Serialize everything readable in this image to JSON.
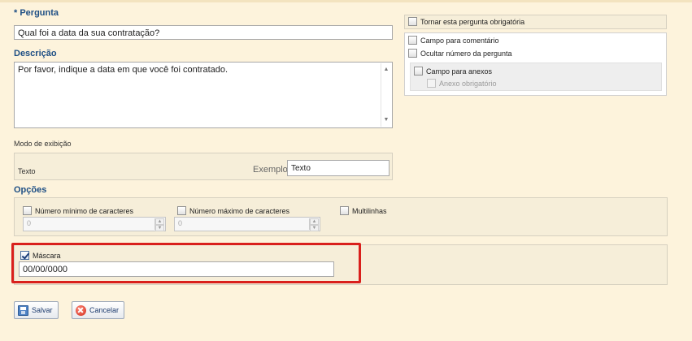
{
  "question": {
    "label": "* Pergunta",
    "value": "Qual foi a data da sua contratação?"
  },
  "description": {
    "label": "Descrição",
    "value": "Por favor, indique a data em que você foi contratado."
  },
  "options_right": {
    "required": "Tornar esta pergunta obrigatória",
    "comment_field": "Campo para comentário",
    "hide_number": "Ocultar número da pergunta",
    "attachments": "Campo para anexos",
    "attachment_required": "Anexo obrigatório"
  },
  "display_mode": {
    "label": "Modo de exibição",
    "value": "Texto",
    "example_label": "Exemplo:",
    "example_value": "Texto"
  },
  "options": {
    "label": "Opções",
    "min_chars": {
      "label": "Número mínimo de caracteres",
      "value": "0"
    },
    "max_chars": {
      "label": "Número máximo de caracteres",
      "value": "0"
    },
    "multiline": "Multilinhas"
  },
  "mask": {
    "label": "Máscara",
    "checked": true,
    "value": "00/00/0000"
  },
  "buttons": {
    "save": "Salvar",
    "cancel": "Cancelar"
  },
  "colors": {
    "background": "#fdf3dc",
    "label_blue": "#1d4e84",
    "highlight_red": "#d9201c"
  }
}
